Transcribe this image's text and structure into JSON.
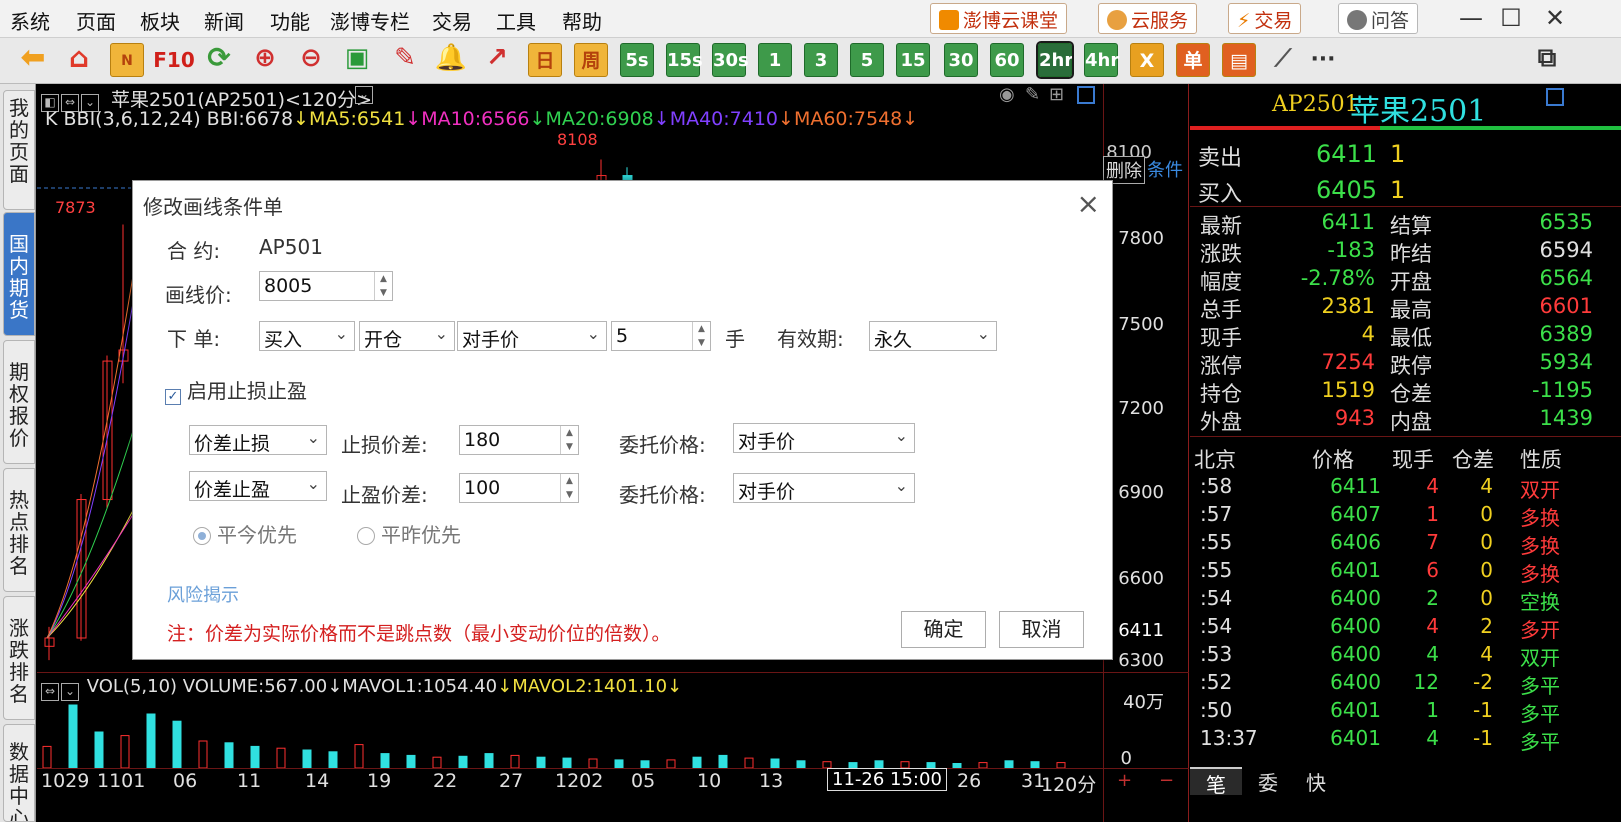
{
  "menu": [
    "系统",
    "页面",
    "板块",
    "新闻",
    "功能",
    "澎博专栏",
    "交易",
    "工具",
    "帮助"
  ],
  "top_buttons": [
    "澎博云课堂",
    "云服务",
    "交易",
    "问答"
  ],
  "window_controls": {
    "minimize": "—",
    "maximize": "☐",
    "close": "✕"
  },
  "toolbar": {
    "f10": "F10",
    "day": "日",
    "week": "周",
    "periods": [
      "5s",
      "15s",
      "30s",
      "1",
      "3",
      "5",
      "15",
      "30",
      "60",
      "2hr",
      "4hr"
    ],
    "selected": "2hr",
    "x": "X",
    "single": "单",
    "more": "···"
  },
  "sidebar": [
    "我的页面",
    "国内期货",
    "期权报价",
    "热点排名",
    "涨跌排名",
    "数据中心"
  ],
  "sidebar_active": "国内期货",
  "chart": {
    "title": "苹果2501(AP2501)<120分>",
    "indicator": {
      "bbi": "K BBI(3,6,12,24) BBI:6678",
      "ma5": "↓MA5:6541",
      "ma10": "↓MA10:6566",
      "ma20": "↓MA20:6908",
      "ma40": "↓MA40:7410",
      "ma60": "↓MA60:7548↓"
    },
    "price_axis": [
      "8100",
      "7800",
      "7500",
      "7200",
      "6900",
      "6600",
      "6411",
      "6300"
    ],
    "high_label": "8108",
    "left_label": "7873",
    "delete_btn": "删除",
    "cond_label": "条件",
    "vol_indicator": {
      "main": "VOL(5,10) VOLUME:567.00",
      "mavol1": "↓MAVOL1:1054.40",
      "mavol2": "↓MAVOL2:1401.10↓"
    },
    "vol_axis": [
      "40万",
      "0"
    ],
    "x_axis": [
      "1029",
      "1101",
      "06",
      "11",
      "14",
      "19",
      "22",
      "27",
      "1202",
      "05",
      "10",
      "13",
      "26",
      "31"
    ],
    "crosshair_time": "11-26 15:00",
    "period_label": "120分",
    "zoom": [
      "+",
      "−"
    ],
    "candles": [
      [
        6350,
        6420,
        6300,
        6380
      ],
      [
        6380,
        6900,
        6370,
        6880
      ],
      [
        6880,
        7400,
        6850,
        7380
      ],
      [
        7380,
        7873,
        7300,
        7420
      ],
      [
        7420,
        7450,
        7200,
        7300
      ],
      [
        7300,
        7320,
        7050,
        7100
      ],
      [
        7100,
        7150,
        6950,
        7000
      ],
      [
        7000,
        7050,
        6900,
        6950
      ],
      [
        6950,
        7000,
        6850,
        6900
      ],
      [
        6900,
        6950,
        6820,
        6880
      ],
      [
        7950,
        8108,
        7900,
        8050
      ],
      [
        8050,
        8080,
        7950,
        8000
      ]
    ],
    "volumes": [
      120,
      350,
      200,
      180,
      300,
      260,
      150,
      140,
      120,
      110,
      100,
      90,
      130,
      80,
      70,
      60,
      65,
      80,
      70,
      60,
      55,
      50,
      45,
      40,
      45,
      60,
      70,
      55,
      50,
      40,
      35,
      30,
      40,
      35,
      30,
      25,
      30,
      40,
      35,
      30
    ]
  },
  "dialog": {
    "title": "修改画线条件单",
    "contract_label": "合    约:",
    "contract_value": "AP501",
    "price_label": "画线价:",
    "price_value": "8005",
    "order_label": "下    单:",
    "side": "买入",
    "openclose": "开仓",
    "price_type": "对手价",
    "qty": "5",
    "qty_unit": "手",
    "validity_label": "有效期:",
    "validity": "永久",
    "stop_enable": "启用止损止盈",
    "sl_type": "价差止损",
    "sl_label": "止损价差:",
    "sl_value": "180",
    "sl_entrust_label": "委托价格:",
    "sl_entrust": "对手价",
    "tp_type": "价差止盈",
    "tp_label": "止盈价差:",
    "tp_value": "100",
    "tp_entrust_label": "委托价格:",
    "tp_entrust": "对手价",
    "radio1": "平今优先",
    "radio2": "平昨优先",
    "risk_link": "风险揭示",
    "note": "注：价差为实际价格而不是跳点数（最小变动价位的倍数）。",
    "ok": "确定",
    "cancel": "取消"
  },
  "quote": {
    "code": "AP2501",
    "name": "苹果2501",
    "sell_label": "卖出",
    "sell_price": "6411",
    "sell_qty": "1",
    "buy_label": "买入",
    "buy_price": "6405",
    "buy_qty": "1",
    "rows": [
      [
        "最新",
        "6411",
        "结算",
        "6535"
      ],
      [
        "涨跌",
        "-183",
        "昨结",
        "6594"
      ],
      [
        "幅度",
        "-2.78%",
        "开盘",
        "6564"
      ],
      [
        "总手",
        "2381",
        "最高",
        "6601"
      ],
      [
        "现手",
        "4",
        "最低",
        "6389"
      ],
      [
        "涨停",
        "7254",
        "跌停",
        "5934"
      ],
      [
        "持仓",
        "1519",
        "仓差",
        "-1195"
      ],
      [
        "外盘",
        "943",
        "内盘",
        "1439"
      ]
    ],
    "row_colors": [
      [
        "#3ce04a",
        "#3ce04a"
      ],
      [
        "#3ce04a",
        "#e0e0e0"
      ],
      [
        "#3ce04a",
        "#3ce04a"
      ],
      [
        "#f0d020",
        "#ff3b3b"
      ],
      [
        "#f0d020",
        "#3ce04a"
      ],
      [
        "#ff3b3b",
        "#3ce04a"
      ],
      [
        "#f0d020",
        "#3ce04a"
      ],
      [
        "#ff3b3b",
        "#3ce04a"
      ]
    ]
  },
  "ticks": {
    "headers": [
      "北京",
      "价格",
      "现手",
      "仓差",
      "性质"
    ],
    "rows": [
      [
        ":58",
        "6411",
        "4",
        "4",
        "双开"
      ],
      [
        ":57",
        "6407",
        "1",
        "0",
        "多换"
      ],
      [
        ":55",
        "6406",
        "7",
        "0",
        "多换"
      ],
      [
        ":55",
        "6401",
        "6",
        "0",
        "多换"
      ],
      [
        ":54",
        "6400",
        "2",
        "0",
        "空换"
      ],
      [
        ":54",
        "6400",
        "4",
        "2",
        "多开"
      ],
      [
        ":53",
        "6400",
        "4",
        "4",
        "双开"
      ],
      [
        ":52",
        "6400",
        "12",
        "-2",
        "多平"
      ],
      [
        ":50",
        "6401",
        "1",
        "-1",
        "多平"
      ],
      [
        "13:37",
        "6401",
        "4",
        "-1",
        "多平"
      ]
    ],
    "qty_colors": [
      "#ff3b3b",
      "#ff3b3b",
      "#ff3b3b",
      "#ff3b3b",
      "#3ce04a",
      "#ff3b3b",
      "#3ce04a",
      "#3ce04a",
      "#3ce04a",
      "#3ce04a"
    ],
    "nature_colors": [
      "#ff3b3b",
      "#ff3b3b",
      "#ff3b3b",
      "#ff3b3b",
      "#3ce04a",
      "#ff3b3b",
      "#3ce04a",
      "#3ce04a",
      "#3ce04a",
      "#3ce04a"
    ]
  },
  "bottom_tabs": [
    "笔",
    "委",
    "快"
  ]
}
